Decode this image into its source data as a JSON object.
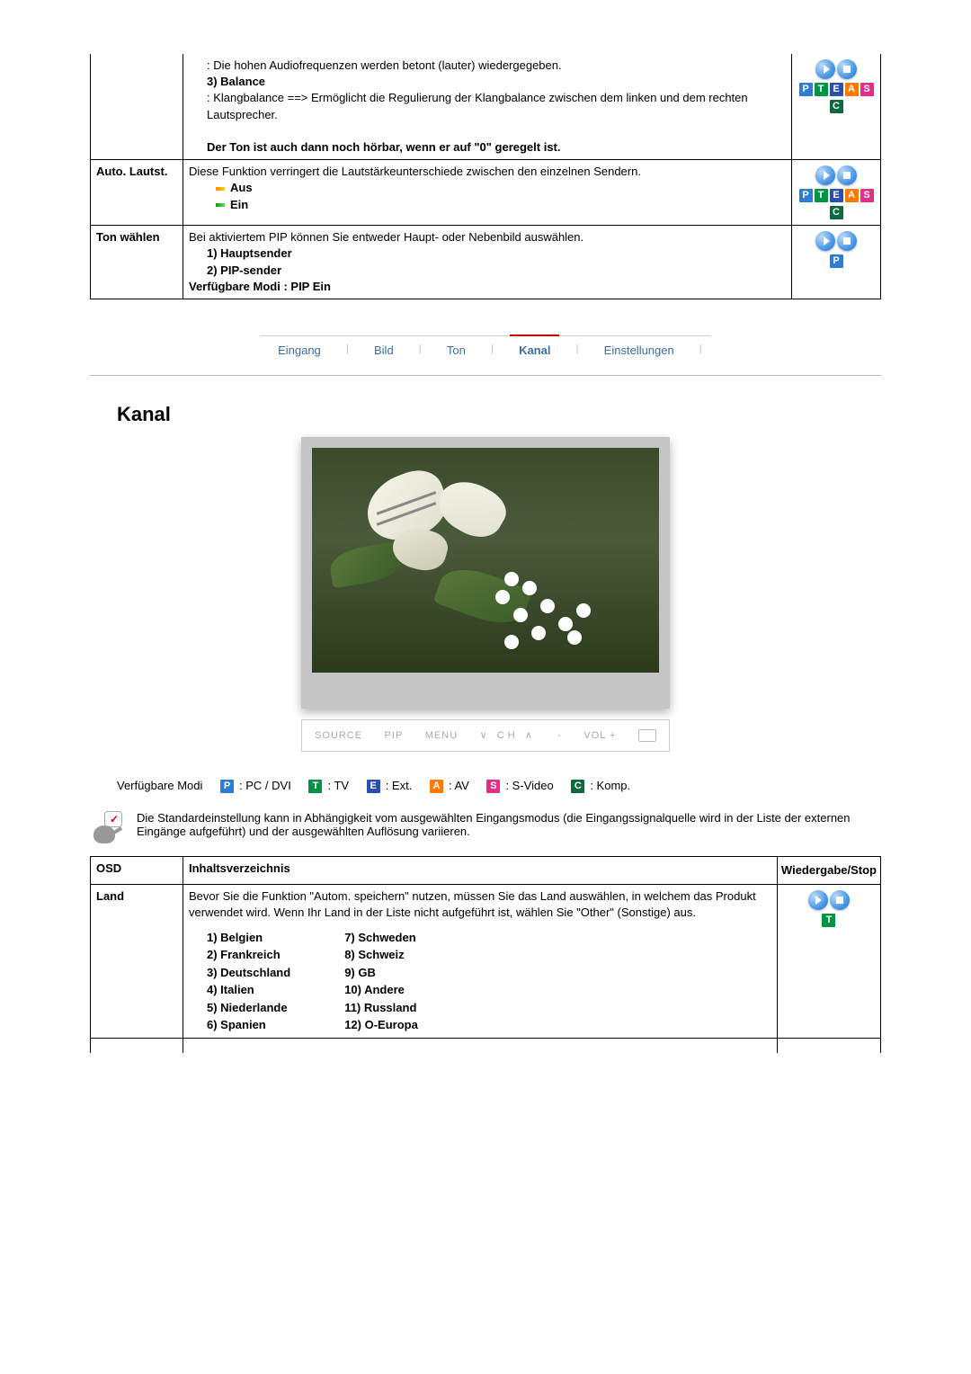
{
  "top_table": {
    "row0": {
      "desc": ": Die hohen Audiofrequenzen werden betont (lauter) wiedergegeben.",
      "balance_label": "3) Balance",
      "balance_desc": ": Klangbalance ==> Ermöglicht die Regulierung der Klangbalance zwischen dem linken und dem rechten Lautsprecher.",
      "note": "Der Ton ist auch dann noch hörbar, wenn er auf \"0\" geregelt ist."
    },
    "row1": {
      "label": "Auto. Lautst.",
      "desc": "Diese Funktion verringert die Lautstärkeunterschiede zwischen den einzelnen Sendern.",
      "opt_off": "Aus",
      "opt_on": "Ein"
    },
    "row2": {
      "label": "Ton wählen",
      "desc": "Bei aktiviertem PIP können Sie entweder Haupt- oder Nebenbild auswählen.",
      "opt1": "1) Hauptsender",
      "opt2": "2) PIP-sender",
      "avail": "Verfügbare Modi : PIP Ein"
    }
  },
  "tabs": {
    "t1": "Eingang",
    "t2": "Bild",
    "t3": "Ton",
    "t4": "Kanal",
    "t5": "Einstellungen"
  },
  "section_title": "Kanal",
  "monitor_buttons": {
    "b1": "SOURCE",
    "b2": "PIP",
    "b3": "MENU",
    "b4": "CH",
    "b5": "-",
    "b6": "VOL +"
  },
  "modi": {
    "label": "Verfügbare Modi",
    "p": ": PC / DVI",
    "t": ": TV",
    "e": ": Ext.",
    "a": ": AV",
    "s": ": S-Video",
    "c": ": Komp."
  },
  "note_text": "Die Standardeinstellung kann in Abhängigkeit vom ausgewählten Eingangsmodus (die Eingangssignalquelle wird in der Liste der externen Eingänge aufgeführt) und der ausgewählten Auflösung variieren.",
  "bottom_table": {
    "h1": "OSD",
    "h2": "Inhaltsverzeichnis",
    "h3": "Wiedergabe/Stop",
    "land_label": "Land",
    "land_desc": "Bevor Sie die Funktion \"Autom. speichern\" nutzen, müssen Sie das Land auswählen, in welchem das Produkt verwendet wird. Wenn Ihr Land in der Liste nicht aufgeführt ist, wählen Sie \"Other\" (Sonstige) aus.",
    "countries_left": {
      "c1": "1) Belgien",
      "c2": "2) Frankreich",
      "c3": "3) Deutschland",
      "c4": "4) Italien",
      "c5": "5) Niederlande",
      "c6": "6) Spanien"
    },
    "countries_right": {
      "c7": "7) Schweden",
      "c8": "8) Schweiz",
      "c9": "9) GB",
      "c10": "10) Andere",
      "c11": "11) Russland",
      "c12": "12) O-Europa"
    }
  }
}
